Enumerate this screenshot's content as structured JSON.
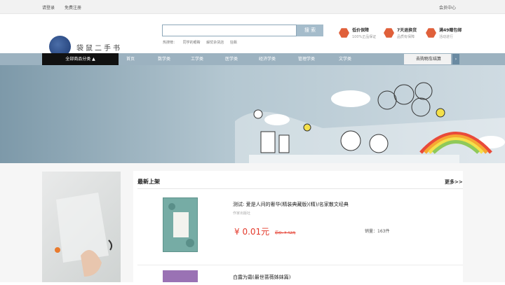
{
  "topbar": {
    "login": "请登录",
    "register": "免费注册",
    "member": "会员中心"
  },
  "logo": {
    "text": "袋鼠二手书"
  },
  "search": {
    "button": "搜 索",
    "hot_label": "热搜榜：",
    "hot": [
      "同学的眼睛",
      "解忧杂货店",
      "狂飙"
    ]
  },
  "promos": [
    {
      "title": "低价保障",
      "desc": "100%正品保证"
    },
    {
      "title": "7天退换货",
      "desc": "品质有保障"
    },
    {
      "title": "满49赠包邮",
      "desc": "活动进行"
    }
  ],
  "nav": {
    "category": "全部商品分类",
    "items": [
      "首页",
      "数学类",
      "工学类",
      "医学类",
      "经济学类",
      "管理学类",
      "文学类"
    ],
    "cart": "去购物车结算"
  },
  "section": {
    "title": "最新上架",
    "more": "更多>>"
  },
  "products": [
    {
      "title": "测试: 爱是人间的奢华(精装典藏版)(精)/名家散文经典",
      "publisher": "作家出版社",
      "price": "¥ 0.01元",
      "old_price": "原价: ¥ 42元",
      "sales": "销量：163件"
    },
    {
      "title": "白露为霜(最世蔷薇姊妹篇)"
    }
  ]
}
